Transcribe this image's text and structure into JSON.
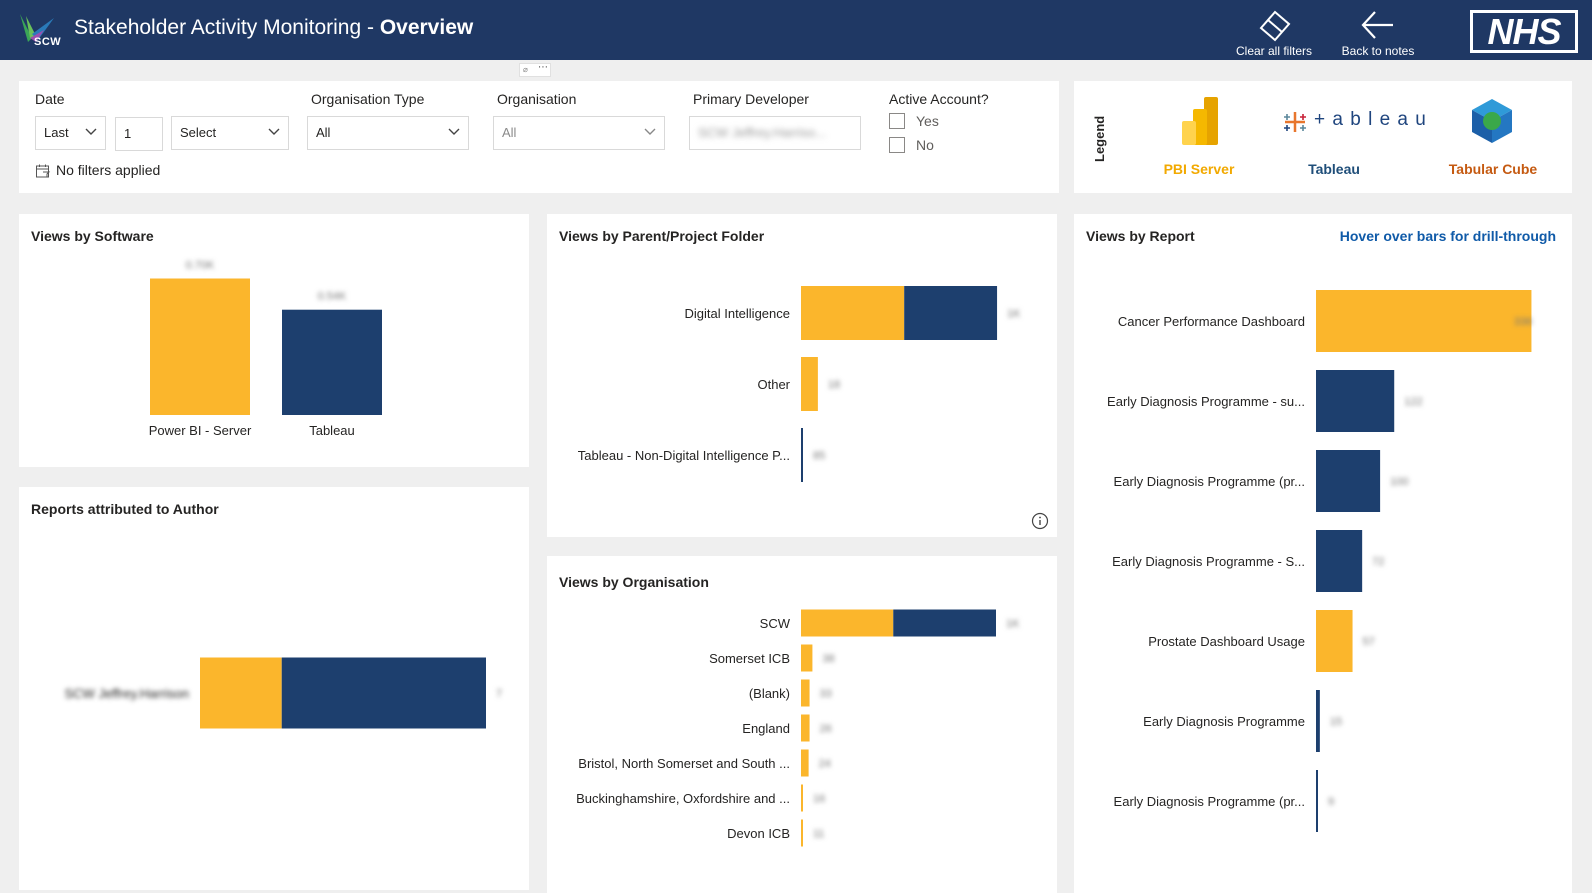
{
  "header": {
    "logo_text": "SCW",
    "title_main": "Stakeholder Activity Monitoring - ",
    "title_bold": "Overview",
    "clear_filters": "Clear all filters",
    "back_to_notes": "Back to notes",
    "brand": "NHS"
  },
  "filters": {
    "date_label": "Date",
    "date_mode": "Last",
    "date_count": "1",
    "date_unit": "Select",
    "no_filters": "No filters applied",
    "org_type_label": "Organisation Type",
    "org_type_value": "All",
    "org_label": "Organisation",
    "org_value": "All",
    "primary_dev_label": "Primary Developer",
    "primary_dev_value": "SCW Jeffrey.Harriso...",
    "active_label": "Active Account?",
    "active_yes": "Yes",
    "active_no": "No"
  },
  "legend": {
    "label": "Legend",
    "items": [
      {
        "name": "PBI Server",
        "color": "#f2a900"
      },
      {
        "name": "Tableau",
        "color": "#1f4e79"
      },
      {
        "name": "Tabular Cube",
        "color": "#c55a11"
      }
    ],
    "tableau_wordmark": "+ a b l e a u"
  },
  "colors": {
    "pbi": "#fbb62c",
    "tableau": "#1d3f6e",
    "accent": "#0f5aa8"
  },
  "panels": {
    "software_title": "Views by Software",
    "folder_title": "Views by Parent/Project Folder",
    "report_title": "Views by Report",
    "report_hint": "Hover over bars for drill-through",
    "author_title": "Reports attributed to Author",
    "org_title": "Views by Organisation"
  },
  "chart_data": [
    {
      "type": "bar",
      "title": "Views by Software",
      "categories": [
        "Power BI - Server",
        "Tableau"
      ],
      "values": [
        0.7,
        0.54
      ],
      "data_labels": [
        "0.70K",
        "0.54K"
      ],
      "ylim": [
        0,
        0.8
      ]
    },
    {
      "type": "bar",
      "orientation": "horizontal",
      "stacked": true,
      "title": "Views by Parent/Project Folder",
      "categories": [
        "Digital Intelligence",
        "Other",
        "Tableau - Non-Digital Intelligence P..."
      ],
      "series": [
        {
          "values": [
            110,
            18,
            0
          ]
        },
        {
          "values": [
            99,
            0,
            2
          ]
        }
      ],
      "data_labels": [
        "1K",
        "18",
        "85"
      ],
      "xlim": [
        0,
        210
      ]
    },
    {
      "type": "bar",
      "orientation": "horizontal",
      "title": "Views by Report",
      "categories": [
        "Cancer Performance Dashboard",
        "Early Diagnosis Programme - su...",
        "Early Diagnosis Programme (pr...",
        "Early Diagnosis Programme - S...",
        "Prostate Dashboard Usage",
        "Early Diagnosis Programme",
        "Early Diagnosis Programme (pr..."
      ],
      "values": [
        336,
        122,
        100,
        72,
        57,
        6,
        3
      ],
      "series_by_bar": [
        "pbi",
        "tableau",
        "tableau",
        "tableau",
        "pbi",
        "tableau",
        "tableau"
      ],
      "data_labels": [
        "336",
        "122",
        "100",
        "72",
        "57",
        "15",
        "9"
      ],
      "xlim": [
        0,
        340
      ]
    },
    {
      "type": "bar",
      "orientation": "horizontal",
      "stacked": true,
      "title": "Reports attributed to Author",
      "categories": [
        "SCW Jeffrey.Harrison"
      ],
      "series": [
        {
          "values": [
            2
          ]
        },
        {
          "values": [
            5
          ]
        }
      ],
      "data_labels": [
        "7"
      ],
      "xlim": [
        0,
        7
      ]
    },
    {
      "type": "bar",
      "orientation": "horizontal",
      "stacked": true,
      "title": "Views by Organisation",
      "categories": [
        "SCW",
        "Somerset ICB",
        "(Blank)",
        "England",
        "Bristol, North Somerset and South ...",
        "Buckinghamshire, Oxfordshire and ...",
        "Devon ICB"
      ],
      "series": [
        {
          "values": [
            97,
            12,
            9,
            9,
            8,
            2,
            1
          ]
        },
        {
          "values": [
            108,
            0,
            0,
            0,
            0,
            0,
            0
          ]
        }
      ],
      "data_labels": [
        "1K",
        "38",
        "33",
        "26",
        "24",
        "16",
        "11"
      ],
      "xlim": [
        0,
        205
      ]
    }
  ]
}
